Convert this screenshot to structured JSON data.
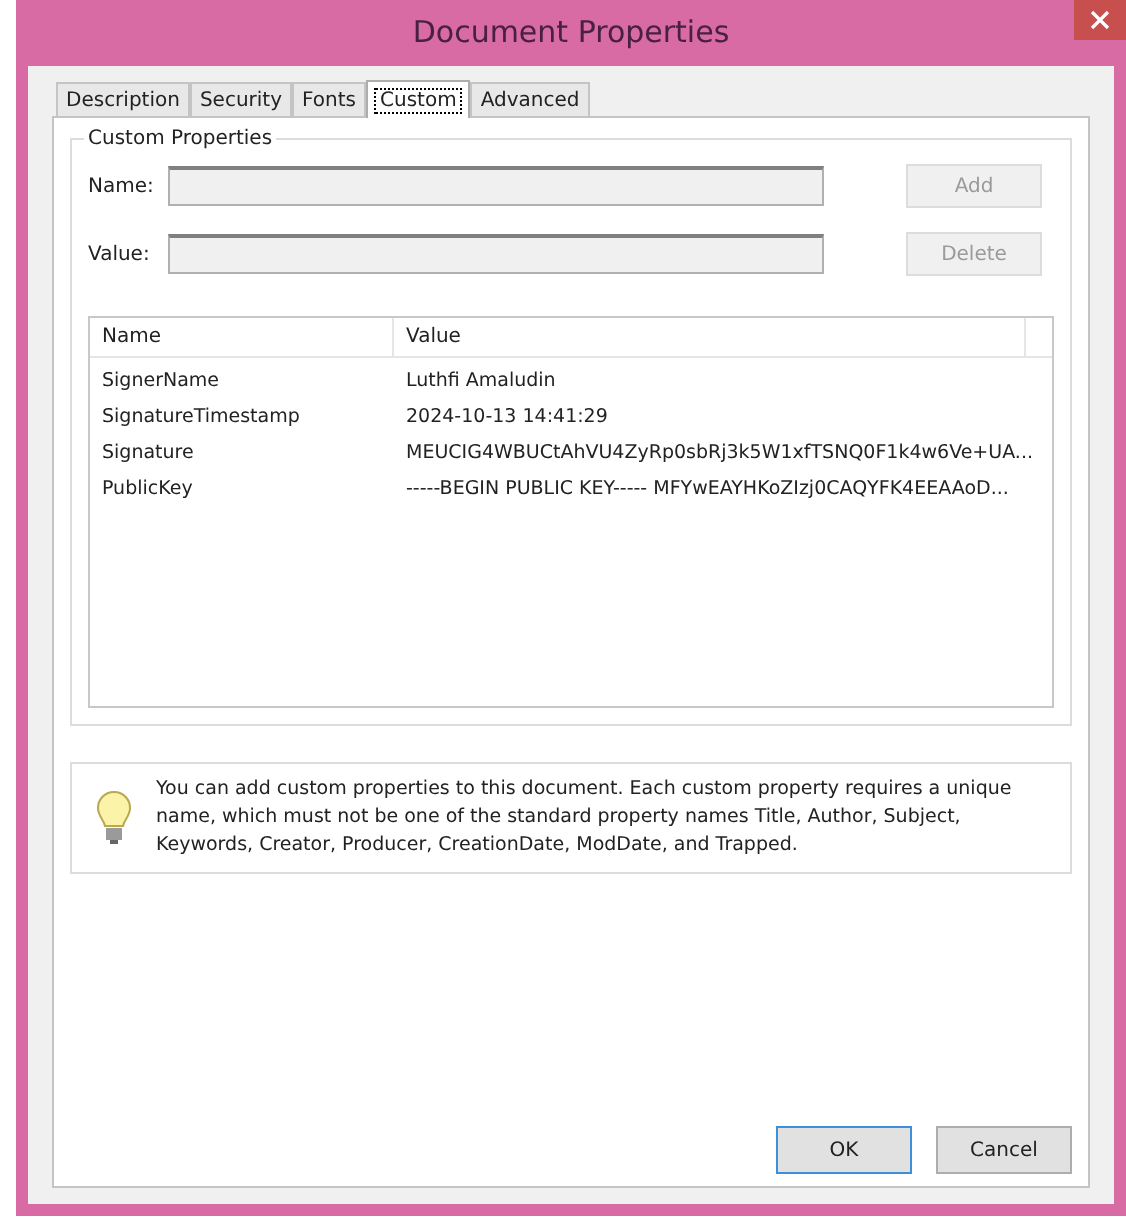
{
  "window": {
    "title": "Document Properties"
  },
  "tabs": [
    {
      "label": "Description",
      "selected": false
    },
    {
      "label": "Security",
      "selected": false
    },
    {
      "label": "Fonts",
      "selected": false
    },
    {
      "label": "Custom",
      "selected": true
    },
    {
      "label": "Advanced",
      "selected": false
    }
  ],
  "group": {
    "title": "Custom Properties",
    "fields": [
      {
        "label": "Name:"
      },
      {
        "label": "Value:"
      }
    ],
    "buttons": [
      {
        "label": "Add",
        "disabled": true
      },
      {
        "label": "Delete",
        "disabled": true
      }
    ]
  },
  "table": {
    "columns": [
      "Name",
      "Value"
    ],
    "rows": [
      [
        "SignerName",
        "Luthfi Amaludin"
      ],
      [
        "SignatureTimestamp",
        "2024-10-13 14:41:29"
      ],
      [
        "Signature",
        "MEUCIG4WBUCtAhVU4ZyRp0sbRj3k5W1xfTSNQ0F1k4w6Ve+UA..."
      ],
      [
        "PublicKey",
        "-----BEGIN PUBLIC KEY----- MFYwEAYHKoZIzj0CAQYFK4EEAAoD..."
      ]
    ]
  },
  "info": {
    "text": "You can add custom properties to this document. Each custom property requires a unique name, which must not be one of the standard property names Title, Author, Subject, Keywords, Creator, Producer, CreationDate, ModDate, and Trapped."
  },
  "buttons": [
    {
      "label": "OK"
    },
    {
      "label": "Cancel"
    }
  ]
}
